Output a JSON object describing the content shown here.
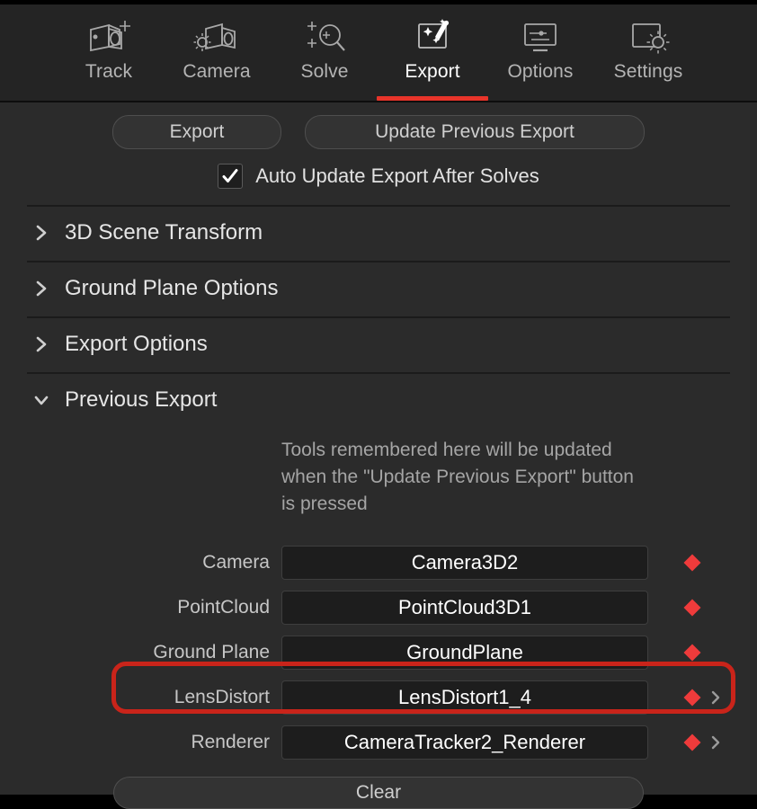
{
  "toolbar": {
    "tabs": [
      {
        "label": "Track",
        "icon": "camera-plus-icon",
        "active": false
      },
      {
        "label": "Camera",
        "icon": "camera-gear-icon",
        "active": false
      },
      {
        "label": "Solve",
        "icon": "magnifier-track-icon",
        "active": false
      },
      {
        "label": "Export",
        "icon": "magic-wand-icon",
        "active": true
      },
      {
        "label": "Options",
        "icon": "monitor-slider-icon",
        "active": false
      },
      {
        "label": "Settings",
        "icon": "frame-gear-icon",
        "active": false
      }
    ],
    "active_accent": "#e8342a"
  },
  "actions": {
    "export_label": "Export",
    "update_label": "Update Previous Export",
    "auto_update_label": "Auto Update Export After Solves",
    "auto_update_checked": true
  },
  "sections": [
    {
      "title": "3D Scene Transform",
      "expanded": false
    },
    {
      "title": "Ground Plane Options",
      "expanded": false
    },
    {
      "title": "Export Options",
      "expanded": false
    },
    {
      "title": "Previous Export",
      "expanded": true
    }
  ],
  "previous_export": {
    "help_text": "Tools remembered here will be updated when the \"Update Previous Export\" button is pressed",
    "rows": [
      {
        "label": "Camera",
        "value": "Camera3D2",
        "has_chevron": false
      },
      {
        "label": "PointCloud",
        "value": "PointCloud3D1",
        "has_chevron": false
      },
      {
        "label": "Ground Plane",
        "value": "GroundPlane",
        "has_chevron": false
      },
      {
        "label": "LensDistort",
        "value": "LensDistort1_4",
        "has_chevron": true
      },
      {
        "label": "Renderer",
        "value": "CameraTracker2_Renderer",
        "has_chevron": true
      }
    ],
    "clear_label": "Clear",
    "marker_color": "#ef3b3b"
  },
  "annotation": {
    "target_row_label": "LensDistort",
    "color": "#c9241a"
  }
}
